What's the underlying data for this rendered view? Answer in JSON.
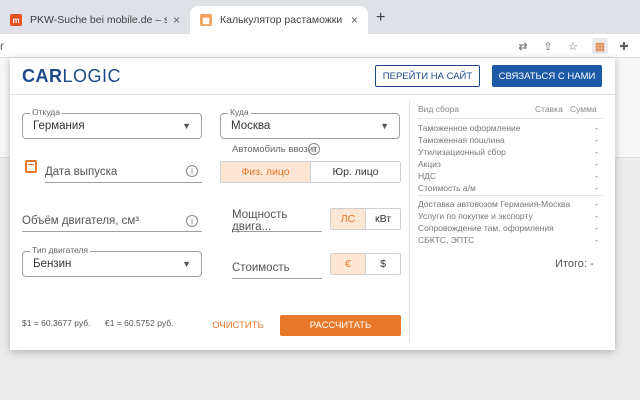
{
  "browser": {
    "tabs": [
      {
        "favicon": "m",
        "title": "PKW-Suche bei mobile.de – sc",
        "close": "×"
      },
      {
        "favicon": "calc-grid-icon",
        "title": "Калькулятор растаможки авт",
        "close": "×"
      }
    ],
    "new_tab": "+"
  },
  "popup": {
    "logo_bold": "CAR",
    "logo_rest": "LOGIC",
    "go_to_site": "ПЕРЕЙТИ НА САЙТ",
    "contact_us": "СВЯЗАТЬСЯ С НАМИ",
    "from": {
      "label": "Откуда",
      "value": "Германия"
    },
    "to": {
      "label": "Куда",
      "value": "Москва"
    },
    "importer_label": "Автомобиль ввозит",
    "importer_options": [
      "Физ. лицо",
      "Юр. лицо"
    ],
    "release_date_placeholder": "Дата выпуска",
    "engine_volume_placeholder": "Объём двигателя, см³",
    "engine_power_placeholder": "Мощность двига...",
    "power_units": [
      "ЛС",
      "кВт"
    ],
    "engine_type": {
      "label": "Тип двигателя",
      "value": "Бензин"
    },
    "cost_placeholder": "Стоимость",
    "currencies": [
      "€",
      "$"
    ],
    "rate_usd": "$1 = 60.3677 руб.",
    "rate_eur": "€1 = 60.5752 руб.",
    "clear": "ОЧИСТИТЬ",
    "calculate": "РАССЧИТАТЬ",
    "table": {
      "headers": [
        "Вид сбора",
        "Ставка",
        "Сумма"
      ],
      "group1": [
        {
          "name": "Таможенное оформление",
          "value": "-"
        },
        {
          "name": "Таможенная пошлина",
          "value": "-"
        },
        {
          "name": "Утилизационный сбор",
          "value": "-"
        },
        {
          "name": "Акциз",
          "value": "-"
        },
        {
          "name": "НДС",
          "value": "-"
        },
        {
          "name": "Стоимость а/м",
          "value": "-"
        }
      ],
      "group2": [
        {
          "name": "Доставка автовозом Германия-Москва",
          "value": "-"
        },
        {
          "name": "Услуги по покупке и экспорту",
          "value": "-"
        },
        {
          "name": "Сопровождение там. оформления",
          "value": "-"
        },
        {
          "name": "СБКТС, ЭПТС",
          "value": "-"
        }
      ],
      "total": "Итого: -"
    }
  },
  "colors": {
    "brand_blue": "#1c4a8a",
    "accent_orange": "#e8782a"
  }
}
